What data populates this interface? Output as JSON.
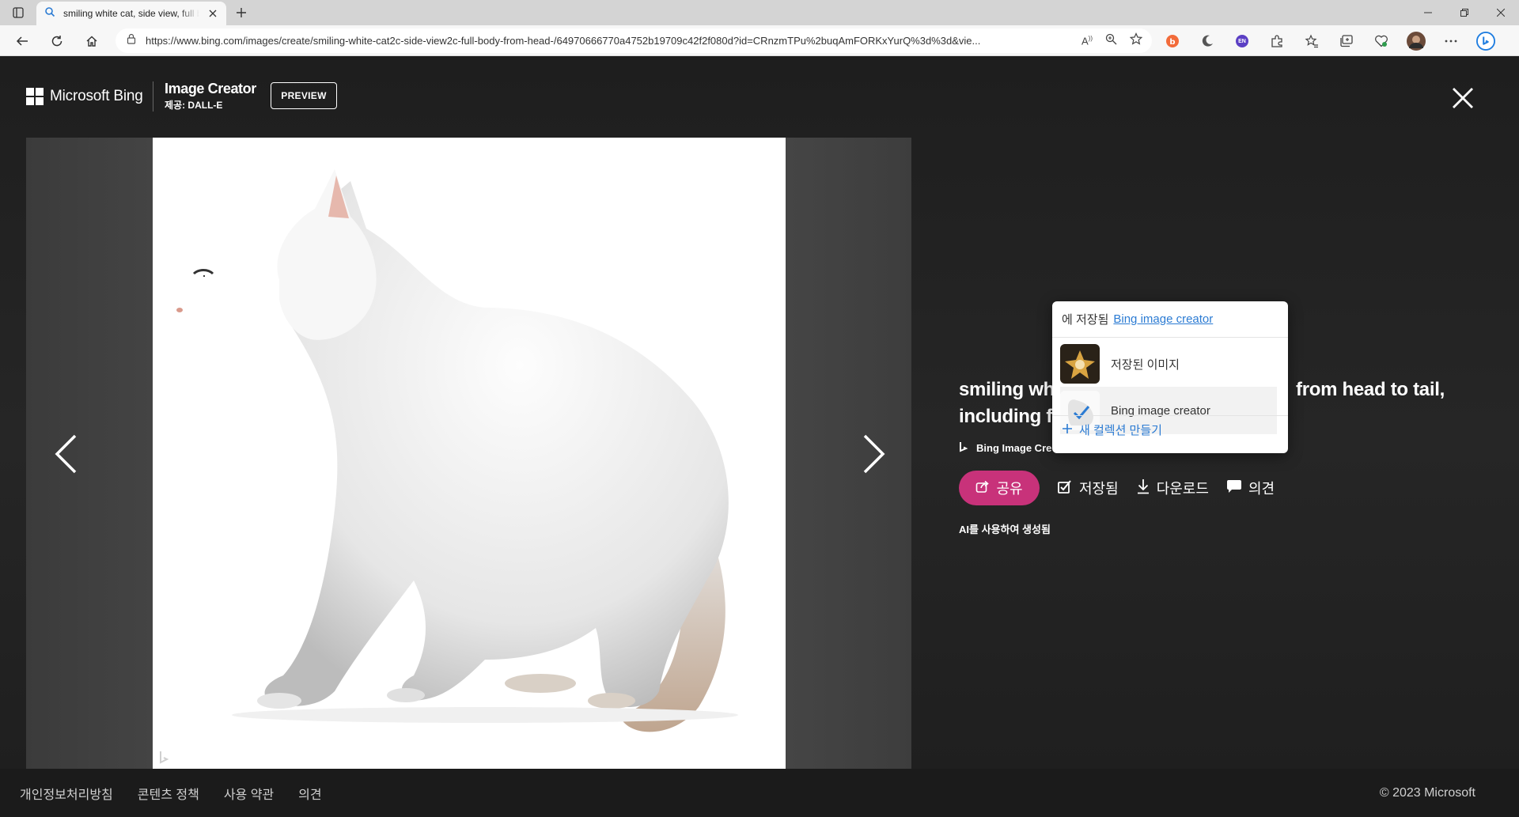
{
  "browser": {
    "tab_title": "smiling white cat, side view, full body",
    "url": "https://www.bing.com/images/create/smiling-white-cat2c-side-view2c-full-body-from-head-/64970666770a4752b19709c42f2f080d?id=CRnzmTPu%2buqAmFORKxYurQ%3d%3d&vie...",
    "profile_badge": "EN"
  },
  "header": {
    "brand": "Microsoft Bing",
    "product": "Image Creator",
    "provider": "제공: DALL-E",
    "preview": "PREVIEW"
  },
  "details": {
    "title_line1": "smiling wh",
    "title_line1_end": "from head to tail,",
    "title_line2": "including f",
    "source": "Bing Image Cre",
    "share": "공유",
    "saved": "저장됨",
    "download": "다운로드",
    "feedback": "의견",
    "ai_note": "AI를 사용하여 생성됨"
  },
  "popup": {
    "saved_in": "에 저장됨",
    "collection_link": "Bing image creator",
    "items": [
      {
        "label": "저장된 이미지"
      },
      {
        "label": "Bing image creator"
      }
    ],
    "new_collection": "새 컬렉션 만들기"
  },
  "footer": {
    "links": [
      "개인정보처리방침",
      "콘텐츠 정책",
      "사용 약관",
      "의견"
    ],
    "copyright": "© 2023 Microsoft"
  },
  "colors": {
    "accent_share": "#c8327a",
    "link_blue": "#2b7bd3",
    "page_bg": "#1e1e1e"
  }
}
